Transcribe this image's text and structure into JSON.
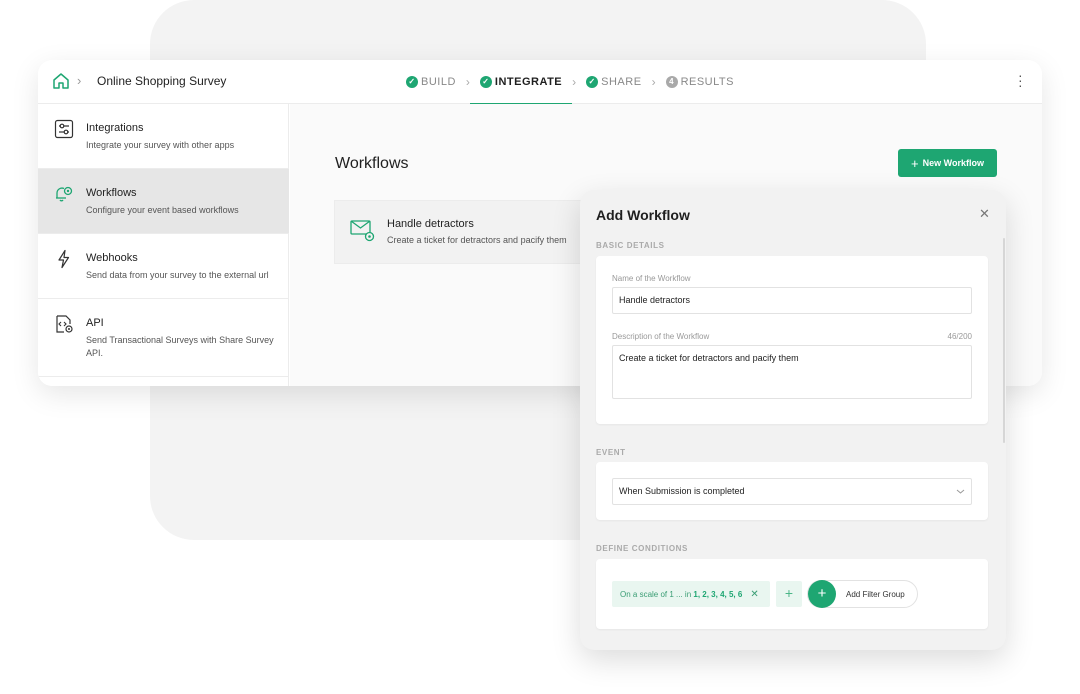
{
  "header": {
    "survey_title": "Online Shopping Survey",
    "steps": [
      {
        "label": "BUILD",
        "state": "done"
      },
      {
        "label": "INTEGRATE",
        "state": "active"
      },
      {
        "label": "SHARE",
        "state": "done"
      },
      {
        "label": "RESULTS",
        "state": "pending",
        "number": "4"
      }
    ],
    "more_icon": "kebab-vertical-icon"
  },
  "sidebar": {
    "items": [
      {
        "title": "Integrations",
        "desc": "Integrate your survey with other apps",
        "icon": "sliders-icon"
      },
      {
        "title": "Workflows",
        "desc": "Configure your event based workflows",
        "icon": "bell-gear-icon",
        "active": true
      },
      {
        "title": "Webhooks",
        "desc": "Send data from your survey to the external url",
        "icon": "lightning-icon"
      },
      {
        "title": "API",
        "desc": "Send Transactional Surveys with Share Survey API.",
        "icon": "code-file-icon"
      }
    ]
  },
  "main": {
    "title": "Workflows",
    "new_button": "New Workflow",
    "workflow_card": {
      "title": "Handle detractors",
      "desc": "Create a ticket for detractors and pacify them",
      "icon": "mail-gear-icon"
    }
  },
  "modal": {
    "title": "Add Workflow",
    "close_icon": "close-icon",
    "basic_details": {
      "section_label": "BASIC DETAILS",
      "name_label": "Name of the Workflow",
      "name_value": "Handle detractors",
      "desc_label": "Description of the Workflow",
      "desc_counter": "46/200",
      "desc_value": "Create a ticket for detractors and pacify them"
    },
    "event": {
      "section_label": "EVENT",
      "selected": "When Submission is completed"
    },
    "conditions": {
      "section_label": "DEFINE CONDITIONS",
      "chip_prefix": "On a scale of 1 ... in",
      "chip_values": "1, 2, 3, 4, 5, 6",
      "add_filter_group": "Add Filter Group"
    }
  },
  "colors": {
    "accent": "#1ea672",
    "chip_bg": "#e9f6f0",
    "active_sidebar_bg": "#e6e6e6"
  }
}
